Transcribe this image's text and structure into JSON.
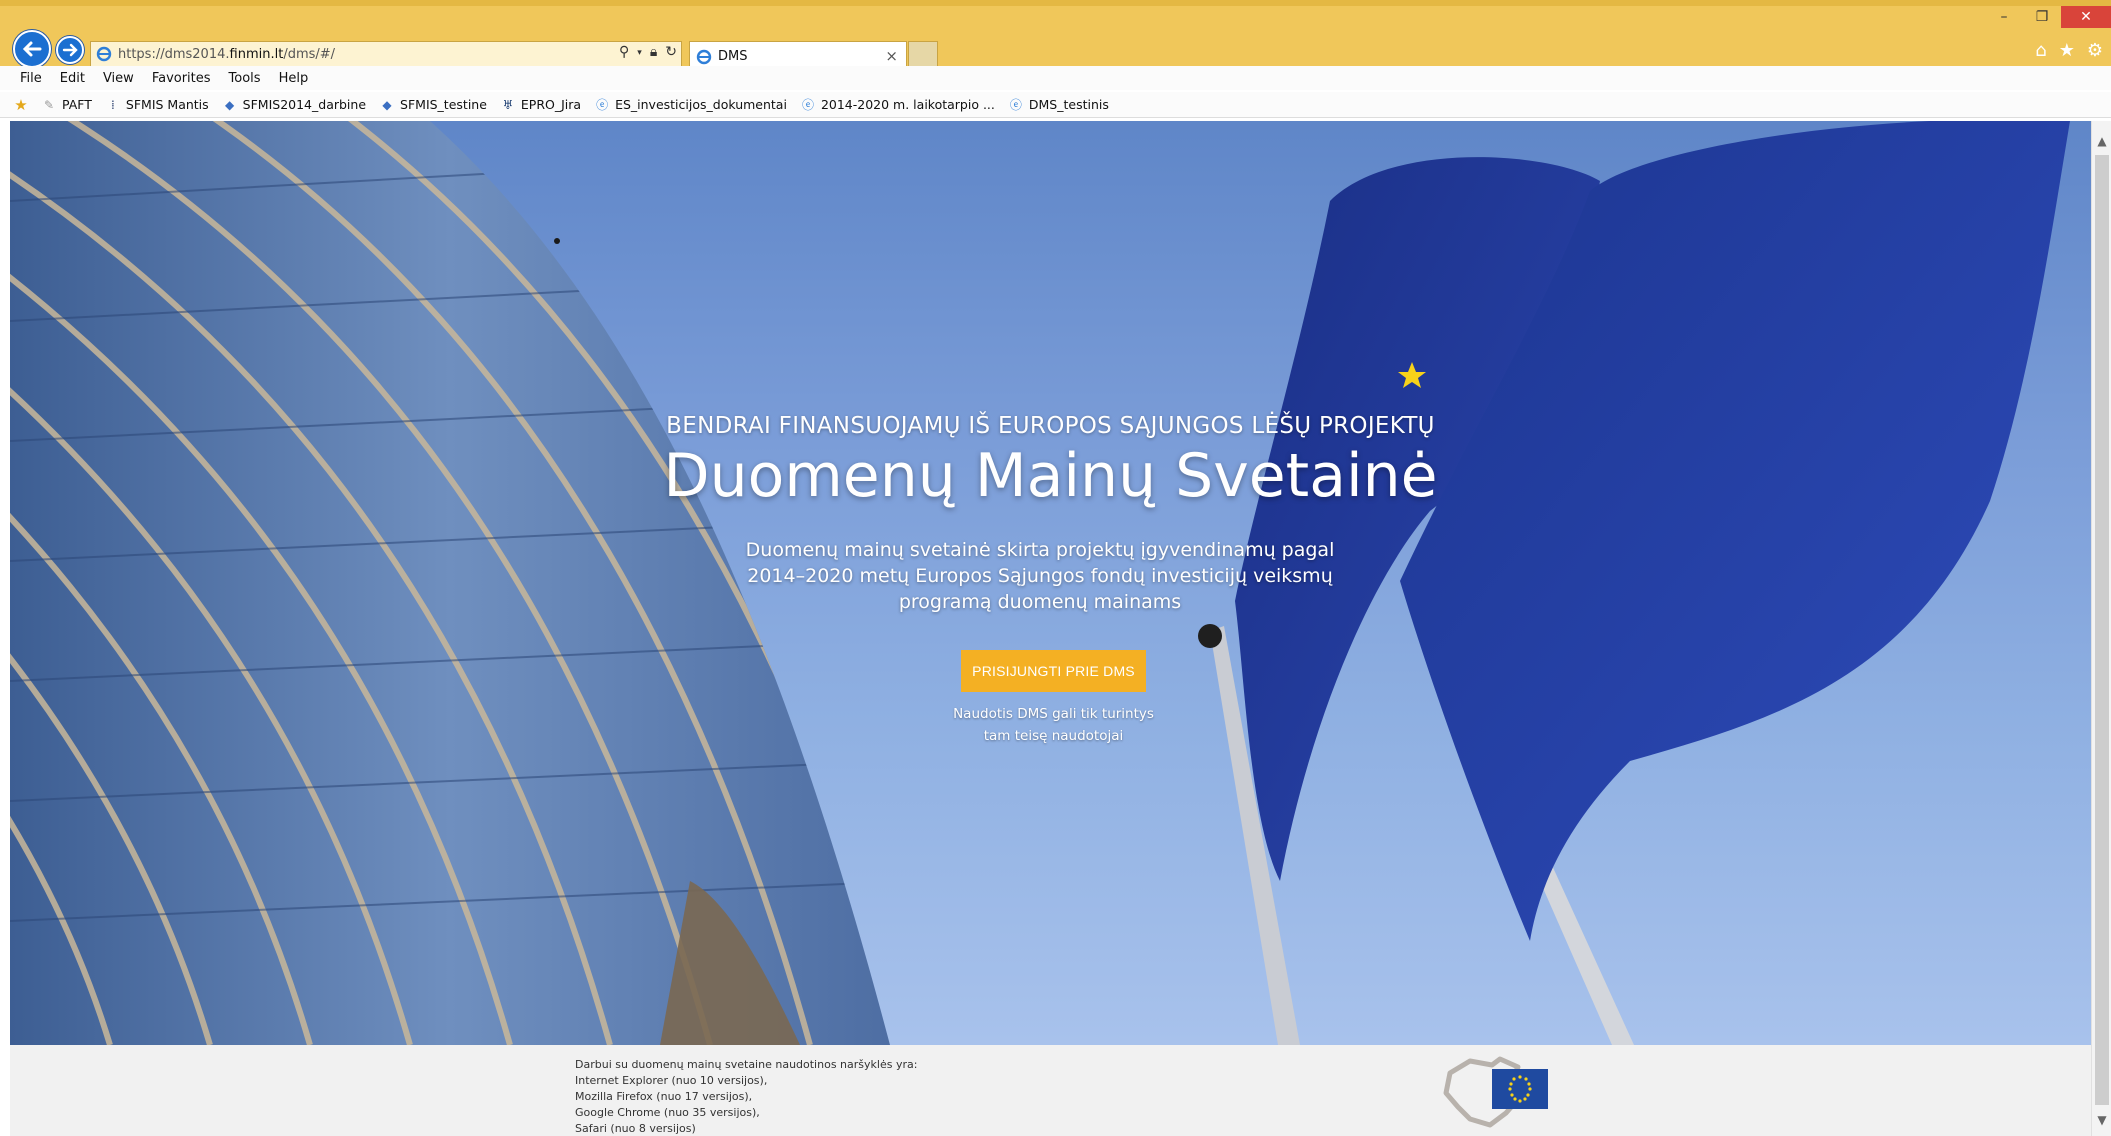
{
  "browser": {
    "url_prefix": "https://dms2014.",
    "url_domain": "finmin.lt",
    "url_suffix": "/dms/#/",
    "tab_title": "DMS",
    "tab_close": "×",
    "window_minimize": "–",
    "window_restore": "❐",
    "window_close": "✕"
  },
  "menu": [
    "File",
    "Edit",
    "View",
    "Favorites",
    "Tools",
    "Help"
  ],
  "favorites": [
    {
      "label": "PAFT",
      "icon": "paft-icon"
    },
    {
      "label": "SFMIS Mantis",
      "icon": "mantis-icon"
    },
    {
      "label": "SFMIS2014_darbine",
      "icon": "sfmis-icon"
    },
    {
      "label": "SFMIS_testine",
      "icon": "sfmis-icon"
    },
    {
      "label": "EPRO_Jira",
      "icon": "jira-icon"
    },
    {
      "label": "ES_investicijos_dokumentai",
      "icon": "ie-page-icon"
    },
    {
      "label": "2014-2020 m. laikotarpio ...",
      "icon": "ie-page-icon"
    },
    {
      "label": "DMS_testinis",
      "icon": "ie-page-icon"
    }
  ],
  "hero": {
    "subtitle": "BENDRAI FINANSUOJAMŲ IŠ EUROPOS SĄJUNGOS LĖŠŲ PROJEKTŲ",
    "title": "Duomenų Mainų Svetainė",
    "description": "Duomenų mainų svetainė skirta projektų įgyvendinamų pagal 2014–2020 metų Europos Sąjungos fondų investicijų veiksmų programą duomenų mainams",
    "login_button": "PRISIJUNGTI PRIE DMS",
    "note_line1": "Naudotis DMS gali tik turintys",
    "note_line2": "tam teisę naudotojai"
  },
  "footer": {
    "intro": "Darbui su duomenų mainų svetaine naudotinos naršyklės yra:",
    "browsers": [
      "Internet Explorer (nuo 10 versijos),",
      "Mozilla Firefox (nuo 17 versijos),",
      "Google Chrome (nuo 35 versijos),",
      "Safari (nuo 8 versijos)"
    ]
  },
  "colors": {
    "accent": "#f4b023",
    "browser_chrome": "#f0c75a",
    "eu_blue": "#1f4aa0",
    "eu_star": "#f7d21a"
  }
}
